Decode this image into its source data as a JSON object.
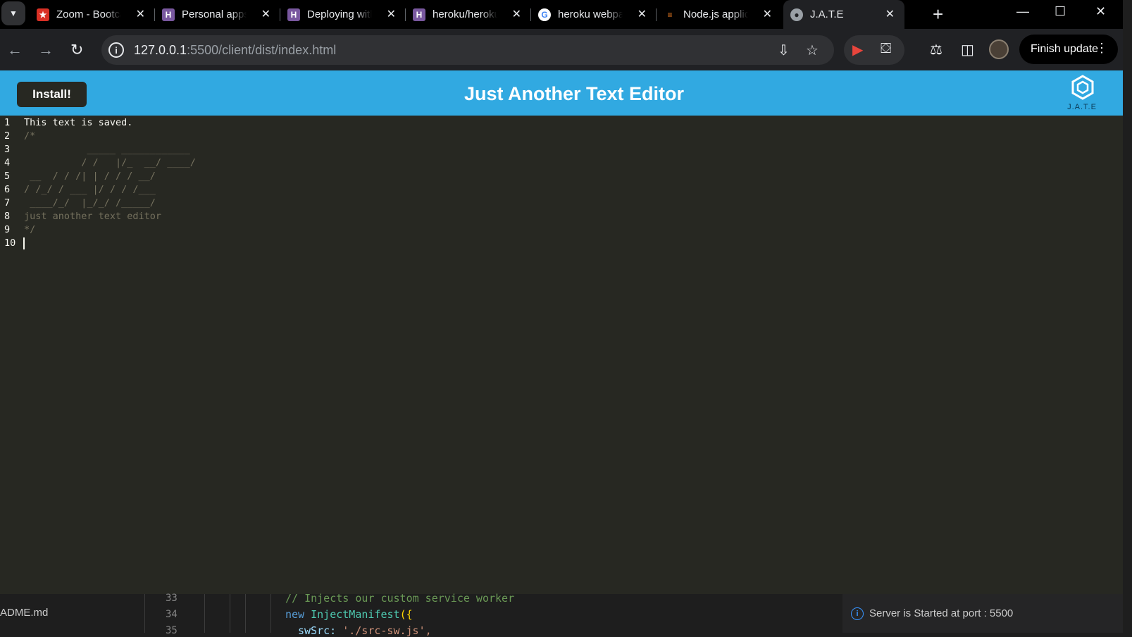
{
  "browser": {
    "tabs": [
      {
        "label": "Zoom - Bootcamp",
        "icon": "zoom-shield-icon",
        "color": "#d93025"
      },
      {
        "label": "Personal apps",
        "icon": "heroku-icon",
        "color": "#79589f"
      },
      {
        "label": "Deploying with",
        "icon": "heroku-icon",
        "color": "#79589f"
      },
      {
        "label": "heroku/heroku",
        "icon": "heroku-icon",
        "color": "#79589f"
      },
      {
        "label": "heroku webpack",
        "icon": "google-icon",
        "color": "#4285f4"
      },
      {
        "label": "Node.js application",
        "icon": "stackoverflow-icon",
        "color": "#f48024"
      },
      {
        "label": "J.A.T.E",
        "icon": "globe-icon",
        "color": "#9aa0a6"
      }
    ],
    "url_host": "127.0.0.1",
    "url_path": ":5500/client/dist/index.html",
    "finish_update_label": "Finish update"
  },
  "app": {
    "install_label": "Install!",
    "title": "Just Another Text Editor",
    "logo_text": "J.A.T.E",
    "header_color": "#31a9e1",
    "editor_bg": "#272822"
  },
  "editor": {
    "lines": [
      {
        "n": "1",
        "text": "This text is saved."
      },
      {
        "n": "2",
        "text": "/*"
      },
      {
        "n": "3",
        "text": "           _____ ____________"
      },
      {
        "n": "4",
        "text": "          / /   |/_  __/ ____/"
      },
      {
        "n": "5",
        "text": " __  / / /| | / / / __/"
      },
      {
        "n": "6",
        "text": "/ /_/ / ___ |/ / / /___"
      },
      {
        "n": "7",
        "text": " ____/_/  |_/_/ /_____/"
      },
      {
        "n": "8",
        "text": "just another text editor"
      },
      {
        "n": "9",
        "text": "*/"
      },
      {
        "n": "10",
        "text": ""
      }
    ]
  },
  "vscode": {
    "file_label": "ADME.md",
    "line_numbers": [
      "33",
      "34",
      "35"
    ],
    "code": {
      "comment": "// Injects our custom service worker",
      "kw_new": "new",
      "cls": "InjectManifest",
      "punc": "({",
      "prop": "swSrc: ",
      "str": "'./src-sw.js',"
    },
    "notification": "Server is Started at port : 5500"
  }
}
